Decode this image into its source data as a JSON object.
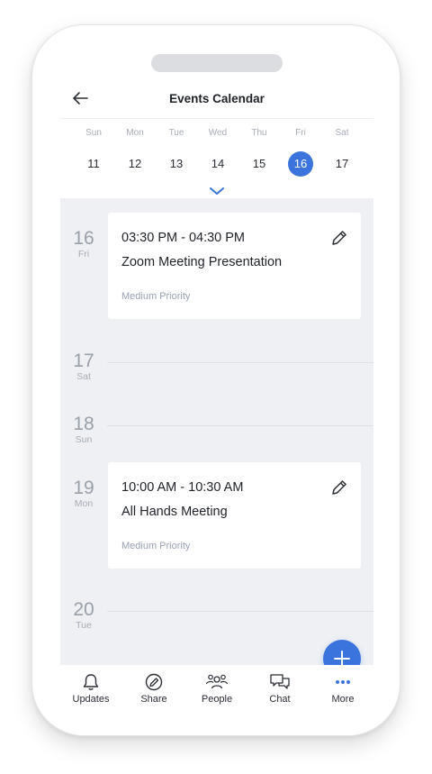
{
  "header": {
    "title": "Events Calendar"
  },
  "week": {
    "days": [
      {
        "name": "Sun",
        "num": "11"
      },
      {
        "name": "Mon",
        "num": "12"
      },
      {
        "name": "Tue",
        "num": "13"
      },
      {
        "name": "Wed",
        "num": "14"
      },
      {
        "name": "Thu",
        "num": "15"
      },
      {
        "name": "Fri",
        "num": "16"
      },
      {
        "name": "Sat",
        "num": "17"
      }
    ],
    "selected": "16"
  },
  "timeline": {
    "dates": [
      {
        "num": "16",
        "dow": "Fri"
      },
      {
        "num": "17",
        "dow": "Sat"
      },
      {
        "num": "18",
        "dow": "Sun"
      },
      {
        "num": "19",
        "dow": "Mon"
      },
      {
        "num": "20",
        "dow": "Tue"
      }
    ],
    "events": [
      {
        "time": "03:30 PM - 04:30 PM",
        "title": "Zoom Meeting Presentation",
        "priority": "Medium Priority"
      },
      {
        "time": "10:00 AM - 10:30 AM",
        "title": "All Hands Meeting",
        "priority": "Medium Priority"
      }
    ]
  },
  "nav": {
    "items": [
      {
        "label": "Updates",
        "icon": "bell-icon"
      },
      {
        "label": "Share",
        "icon": "edit-circle-icon"
      },
      {
        "label": "People",
        "icon": "people-icon"
      },
      {
        "label": "Chat",
        "icon": "chat-icon"
      },
      {
        "label": "More",
        "icon": "more-dots-icon"
      }
    ],
    "active": "More"
  },
  "colors": {
    "accent": "#3b74dc",
    "timeline_bg": "#eef0f4",
    "muted": "#a7adb6"
  }
}
